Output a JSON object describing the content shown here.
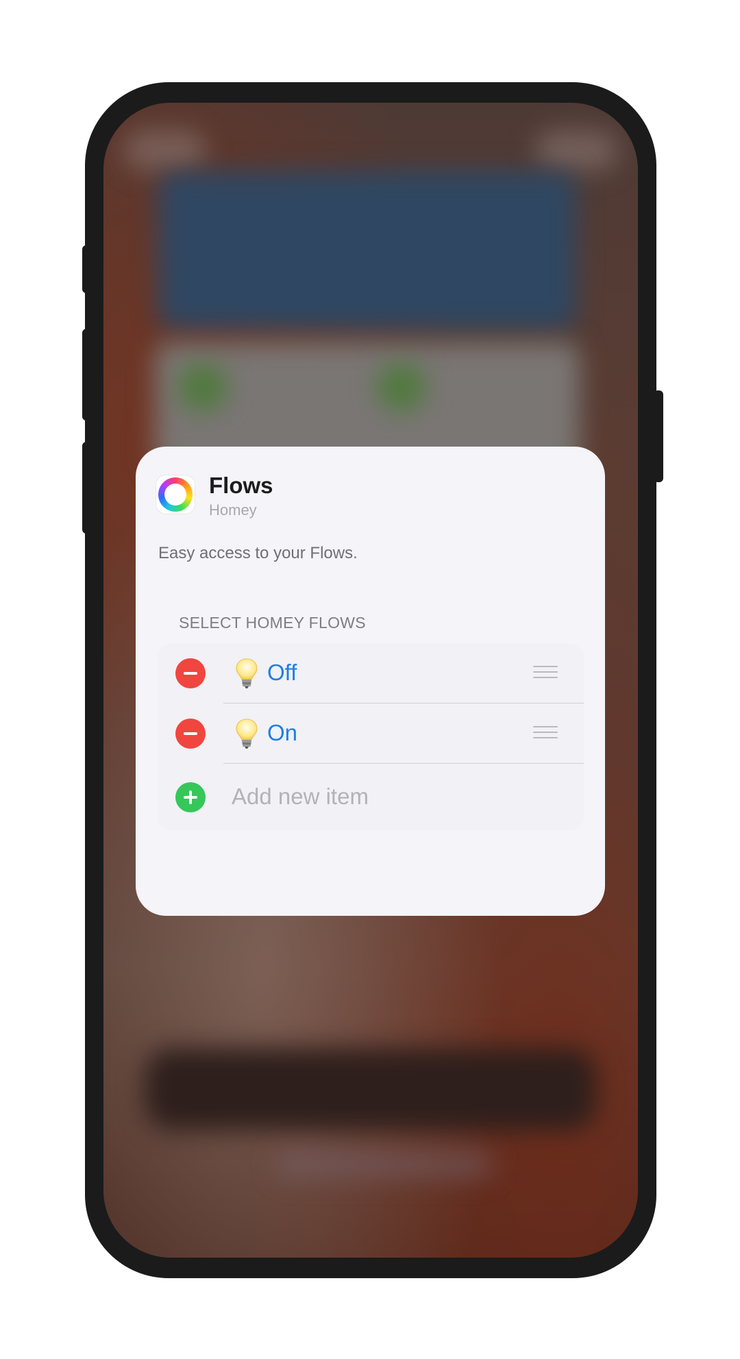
{
  "widget": {
    "title": "Flows",
    "app_name": "Homey",
    "description": "Easy access to your Flows.",
    "section_header": "SELECT HOMEY FLOWS",
    "items": [
      {
        "label": "Off",
        "icon": "lightbulb-icon"
      },
      {
        "label": "On",
        "icon": "lightbulb-icon"
      }
    ],
    "add_item_label": "Add new item"
  },
  "colors": {
    "accent": "#1f7fe0",
    "remove": "#f0463f",
    "add": "#35c759",
    "card_bg": "#f4f4f9",
    "phone_frame": "#1b1b1b"
  }
}
